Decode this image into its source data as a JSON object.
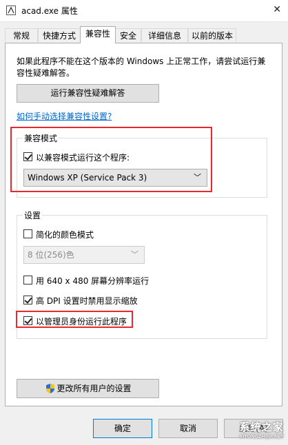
{
  "window": {
    "title": "acad.exe 属性"
  },
  "tabs": [
    {
      "label": "常规"
    },
    {
      "label": "快捷方式"
    },
    {
      "label": "兼容性"
    },
    {
      "label": "安全"
    },
    {
      "label": "详细信息"
    },
    {
      "label": "以前的版本"
    }
  ],
  "active_tab": "兼容性",
  "description": "如果此程序不能在这个版本的 Windows 上正常工作，请尝试运行兼容性疑难解答。",
  "troubleshoot_button": "运行兼容性疑难解答",
  "manual_link": "如何手动选择兼容性设置?",
  "compat_mode": {
    "legend": "兼容模式",
    "checkbox_label": "以兼容模式运行这个程序:",
    "checked": true,
    "selected_os": "Windows XP (Service Pack 3)"
  },
  "settings": {
    "legend": "设置",
    "reduced_color": {
      "label": "简化的颜色模式",
      "checked": false
    },
    "color_select": "8 位(256)色",
    "res_640": {
      "label": "用 640 x 480 屏幕分辨率运行",
      "checked": false
    },
    "high_dpi": {
      "label": "高 DPI 设置时禁用显示缩放",
      "checked": true
    },
    "run_as_admin": {
      "label": "以管理员身份运行此程序",
      "checked": true
    }
  },
  "change_all_users_button": "更改所有用户的设置",
  "footer": {
    "ok": "确定",
    "cancel": "取消",
    "apply": "应用(A)"
  },
  "watermark": {
    "text": "系统之家",
    "sub": "XITONGZHIJIA.NET"
  },
  "colors": {
    "highlight_border": "#e8282d",
    "link": "#0066cc"
  }
}
